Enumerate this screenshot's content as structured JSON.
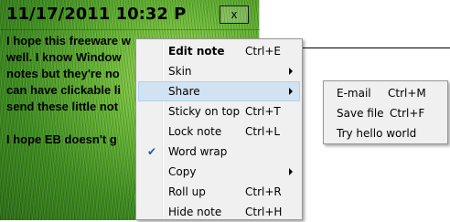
{
  "note": {
    "title": "11/17/2011 10:32 P",
    "close_label": "x",
    "lines": [
      "I hope this freeware w",
      "well. I know Window",
      "notes but they're no",
      "can have clickable li",
      "send these little not",
      "",
      "I hope EB doesn't g"
    ]
  },
  "menu": {
    "items": [
      {
        "label": "Edit note",
        "shortcut": "Ctrl+E",
        "bold": true
      },
      {
        "label": "Skin",
        "shortcut": "",
        "submenu": true
      },
      {
        "label": "Share",
        "shortcut": "",
        "submenu": true,
        "highlighted": true
      },
      {
        "label": "Sticky on top",
        "shortcut": "Ctrl+T"
      },
      {
        "label": "Lock note",
        "shortcut": "Ctrl+L"
      },
      {
        "label": "Word wrap",
        "shortcut": "",
        "checked": true,
        "check_glyph": "✔"
      },
      {
        "label": "Copy",
        "shortcut": "",
        "submenu": true
      },
      {
        "label": "Roll up",
        "shortcut": "Ctrl+R"
      },
      {
        "label": "Hide note",
        "shortcut": "Ctrl+H"
      }
    ]
  },
  "share_submenu": {
    "items": [
      {
        "label": "E-mail",
        "shortcut": "Ctrl+M"
      },
      {
        "label": "Save file",
        "shortcut": "Ctrl+F"
      },
      {
        "label": "Try hello world",
        "shortcut": ""
      }
    ]
  },
  "colors": {
    "menu_background": "#f0f0f0",
    "menu_highlight": "#d1e2f2",
    "grass_light": "#a7dc5d",
    "grass_dark": "#2d6d16"
  }
}
